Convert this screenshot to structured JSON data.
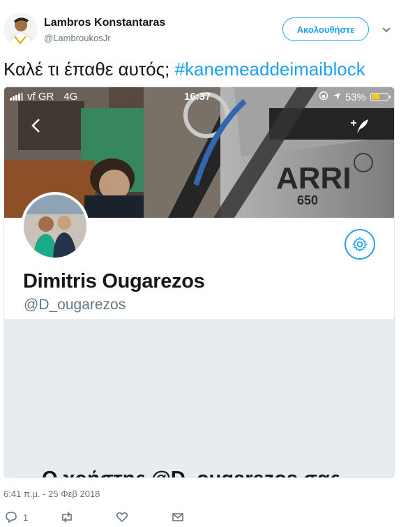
{
  "author": {
    "name": "Lambros Konstantaras",
    "handle": "@LambroukosJr",
    "follow_label": "Ακολουθήστε"
  },
  "tweet": {
    "text": "Καλέ τι έπαθε αυτός; ",
    "hashtag": "#kanemeaddeimaiblock",
    "timestamp": "6:41 π.μ. - 25 Φεβ 2018"
  },
  "screenshot": {
    "status_bar": {
      "carrier": "vf GR",
      "network": "4G",
      "time": "16:37",
      "battery": "53%",
      "battery_level": 0.53
    },
    "banner_text": "ARRI",
    "banner_subtext": "650",
    "profile": {
      "name": "Dimitris Ougarezos",
      "handle": "@D_ougarezos"
    },
    "cut_off_text": "Ο χρήστης @D_ougarezos σας"
  },
  "actions": {
    "reply_count": "1"
  },
  "colors": {
    "accent": "#1da1f2",
    "muted": "#657786",
    "text": "#14171a"
  }
}
